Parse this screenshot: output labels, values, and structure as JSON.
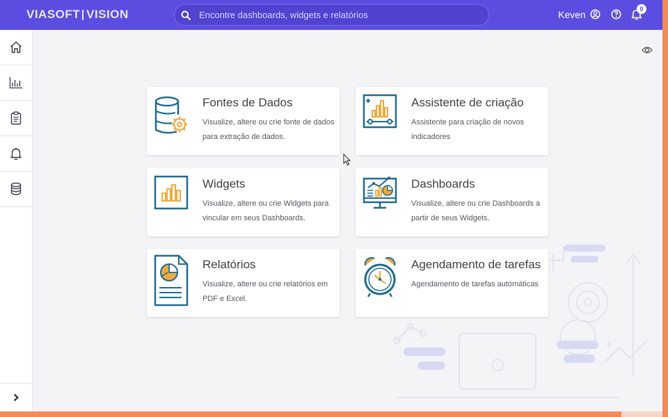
{
  "header": {
    "logo_left": "VIASOFT",
    "logo_right": "VISION",
    "search_placeholder": "Encontre dashboards, widgets e relatórios",
    "user_name": "Keven",
    "notification_count": "0"
  },
  "sidebar": {
    "items": [
      {
        "icon": "home-icon"
      },
      {
        "icon": "chart-icon"
      },
      {
        "icon": "clipboard-icon"
      },
      {
        "icon": "bell-icon"
      },
      {
        "icon": "database-icon"
      }
    ]
  },
  "cards": [
    {
      "title": "Fontes de Dados",
      "desc": "Visualize, altere ou crie fonte de dados para extração de dados."
    },
    {
      "title": "Assistente de criação",
      "desc": "Assistente para criação de novos indicadores"
    },
    {
      "title": "Widgets",
      "desc": "Visualize, altere ou crie Widgets para vincular em seus Dashboards."
    },
    {
      "title": "Dashboards",
      "desc": "Visualize, altere ou crie Dashboards a partir de seus Widgets."
    },
    {
      "title": "Relatórios",
      "desc": "Visualize, altere ou crie relatórios em PDF e Excel."
    },
    {
      "title": "Agendamento de tarefas",
      "desc": "Agendamento de tarefas automáticas"
    }
  ],
  "colors": {
    "brand": "#5b4de0",
    "accent": "#f08a5a",
    "icon_blue": "#1f6b8f",
    "icon_orange": "#f2a93b"
  }
}
